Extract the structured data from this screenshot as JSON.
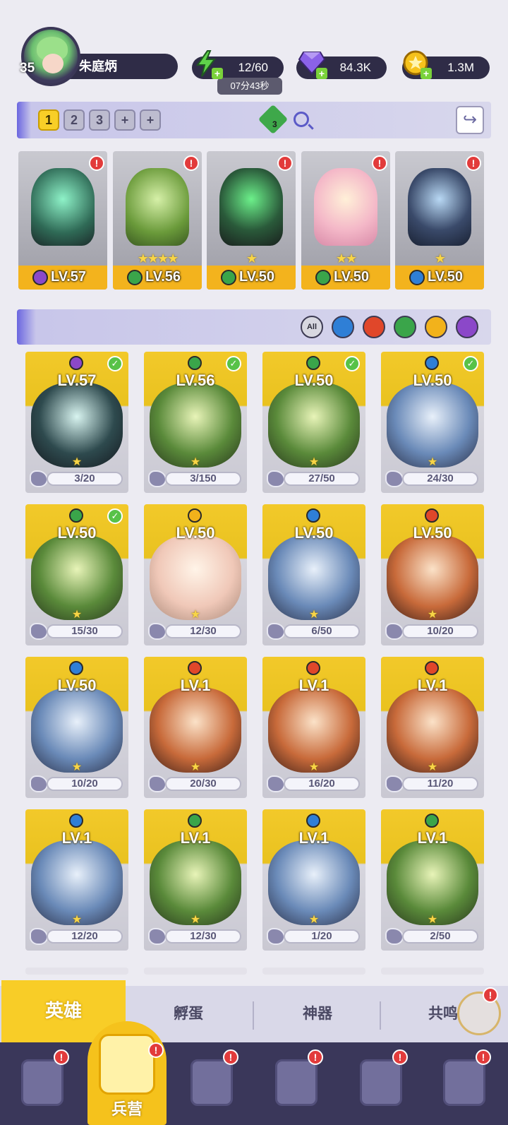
{
  "player": {
    "level": "35",
    "name": "朱庭炳"
  },
  "resources": {
    "stamina": "12/60",
    "stamina_timer": "07分43秒",
    "gems": "84.3K",
    "coins": "1.3M"
  },
  "team_bar": {
    "tabs": [
      "1",
      "2",
      "3",
      "+",
      "+"
    ],
    "active_tab": "1",
    "gem_count": "3"
  },
  "team_slots": [
    {
      "level": "LV.57",
      "element": "dark",
      "stars": ""
    },
    {
      "level": "LV.56",
      "element": "leaf",
      "stars": "★★★★"
    },
    {
      "level": "LV.50",
      "element": "leaf",
      "stars": "★"
    },
    {
      "level": "LV.50",
      "element": "leaf",
      "stars": "★★"
    },
    {
      "level": "LV.50",
      "element": "water",
      "stars": "★"
    }
  ],
  "filter": {
    "all_label": "All",
    "elements": [
      "water",
      "fire",
      "leaf",
      "light",
      "dark"
    ]
  },
  "heroes": [
    {
      "level": "LV.57",
      "element": "dark",
      "progress": "3/20",
      "check": true
    },
    {
      "level": "LV.56",
      "element": "leaf",
      "progress": "3/150",
      "check": true
    },
    {
      "level": "LV.50",
      "element": "leaf",
      "progress": "27/50",
      "check": true
    },
    {
      "level": "LV.50",
      "element": "water",
      "progress": "24/30",
      "check": true
    },
    {
      "level": "LV.50",
      "element": "leaf",
      "progress": "15/30",
      "check": true
    },
    {
      "level": "LV.50",
      "element": "light",
      "progress": "12/30",
      "check": false
    },
    {
      "level": "LV.50",
      "element": "water",
      "progress": "6/50",
      "check": false
    },
    {
      "level": "LV.50",
      "element": "fire",
      "progress": "10/20",
      "check": false
    },
    {
      "level": "LV.50",
      "element": "water",
      "progress": "10/20",
      "check": false
    },
    {
      "level": "LV.1",
      "element": "fire",
      "progress": "20/30",
      "check": false
    },
    {
      "level": "LV.1",
      "element": "fire",
      "progress": "16/20",
      "check": false
    },
    {
      "level": "LV.1",
      "element": "fire",
      "progress": "11/20",
      "check": false
    },
    {
      "level": "LV.1",
      "element": "water",
      "progress": "12/20",
      "check": false
    },
    {
      "level": "LV.1",
      "element": "leaf",
      "progress": "12/30",
      "check": false
    },
    {
      "level": "LV.1",
      "element": "water",
      "progress": "1/20",
      "check": false
    },
    {
      "level": "LV.1",
      "element": "leaf",
      "progress": "2/50",
      "check": false
    }
  ],
  "sub_tabs": [
    "英雄",
    "孵蛋",
    "神器",
    "共鸣"
  ],
  "bottom_nav": {
    "active_label": "兵营"
  },
  "colors": {
    "accent": "#f8cd27",
    "nav_bg": "#3a375a",
    "alert": "#e23b3b"
  }
}
